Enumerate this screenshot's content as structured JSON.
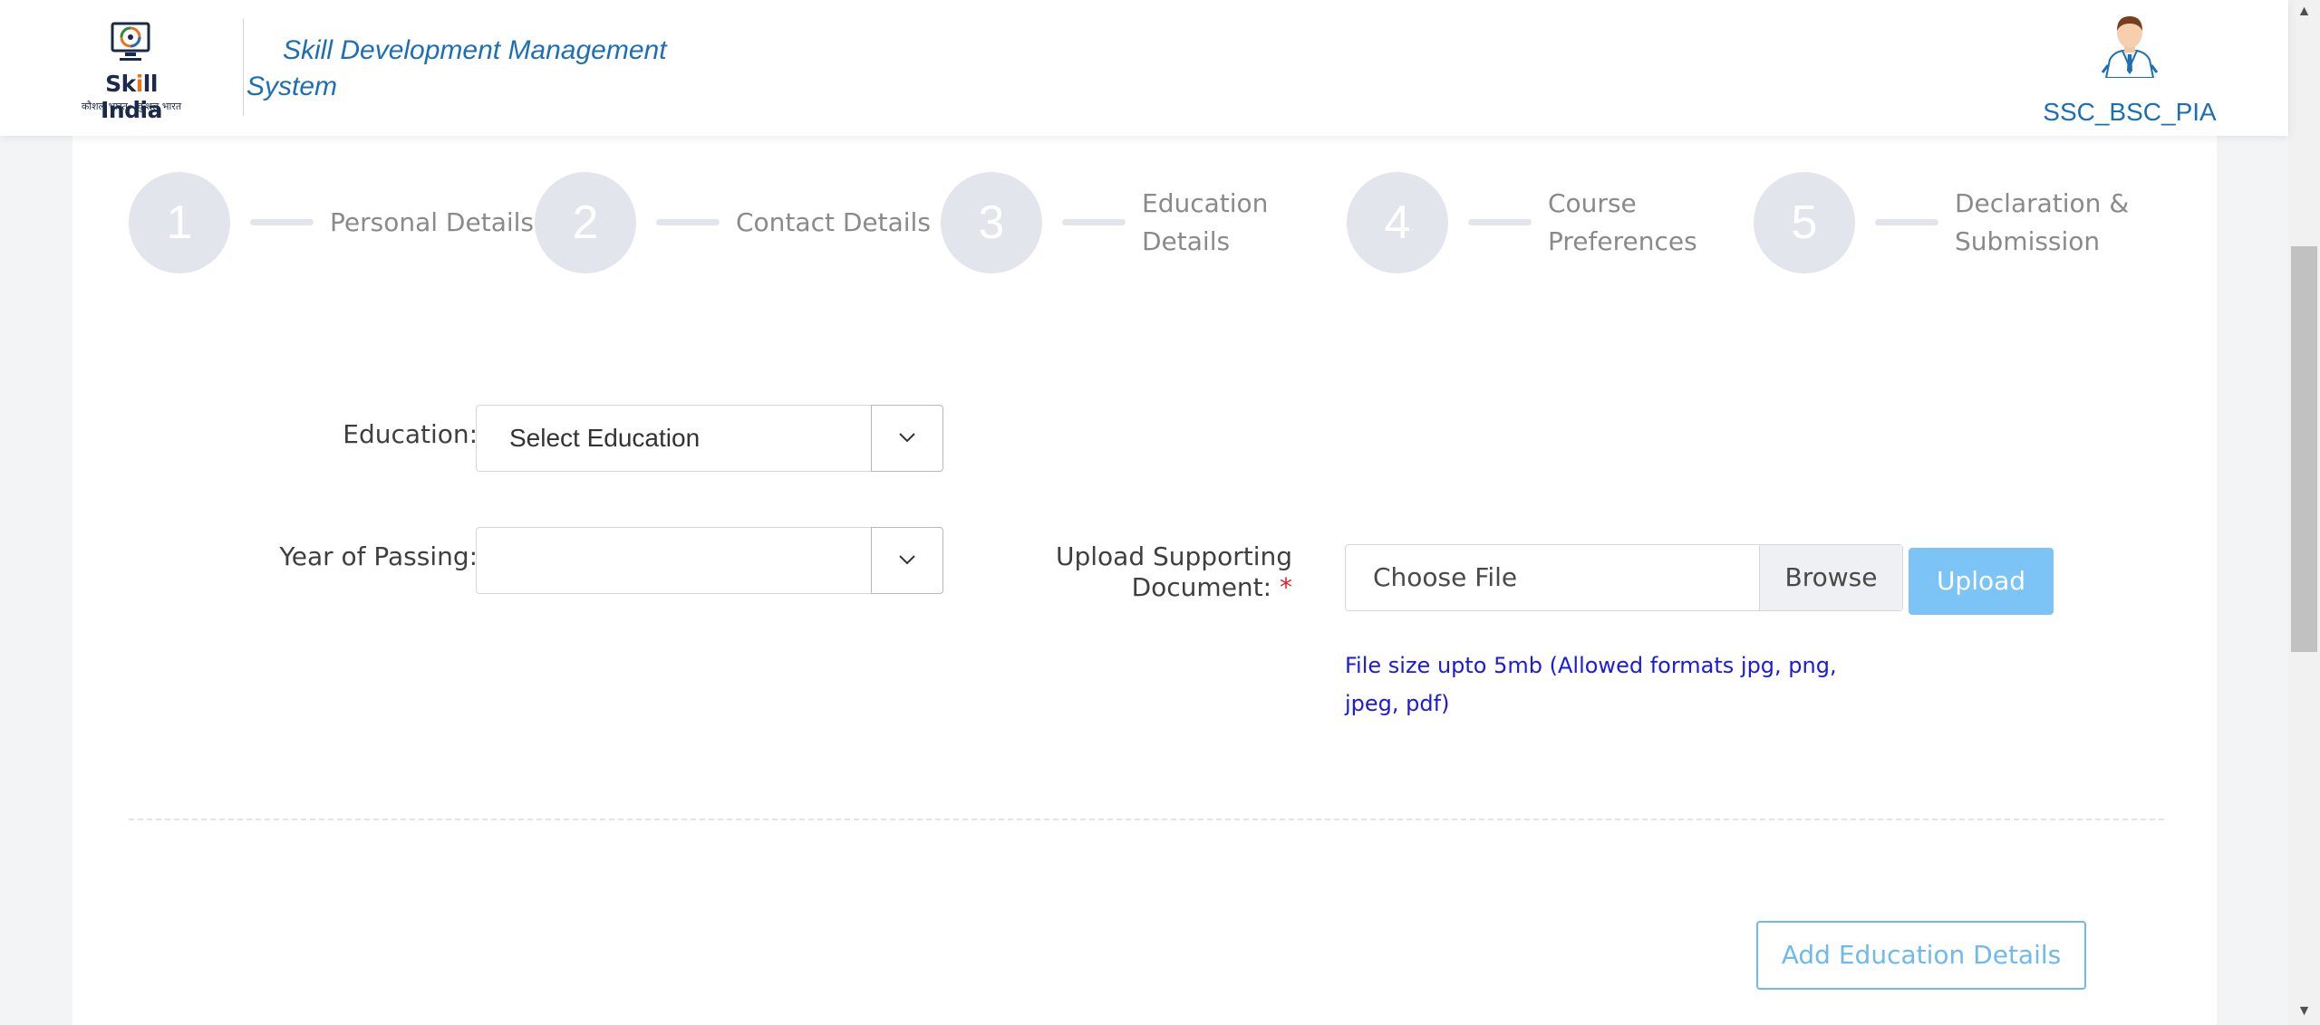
{
  "header": {
    "logo_word_pre": "Sk",
    "logo_word_accent": "i",
    "logo_word_mid": "ll India",
    "logo_tagline": "कौशल भारत - कुशल भारत",
    "app_title": "Skill Development Management System",
    "user_name": "SSC_BSC_PIA"
  },
  "stepper": {
    "steps": [
      {
        "number": "1",
        "label": "Personal Details"
      },
      {
        "number": "2",
        "label": "Contact Details"
      },
      {
        "number": "3",
        "label": "Education Details"
      },
      {
        "number": "4",
        "label": "Course Preferences"
      },
      {
        "number": "5",
        "label": "Declaration & Submission"
      }
    ]
  },
  "form": {
    "education": {
      "label": "Education:",
      "required_mark": "*",
      "value": "Select Education"
    },
    "year_of_passing": {
      "label": "Year of Passing:",
      "required_mark": "*",
      "value": ""
    },
    "upload": {
      "label_line1": "Upload Supporting",
      "label_line2": "Document:",
      "required_mark": "*",
      "file_placeholder": "Choose File",
      "browse_label": "Browse",
      "upload_label": "Upload",
      "hint": "File size upto 5mb (Allowed formats jpg, png, jpeg, pdf)"
    },
    "add_button_label": "Add Education Details"
  },
  "colors": {
    "brand_blue": "#1d6fb5",
    "step_inactive": "#e2e5ec",
    "required_red": "#e02424",
    "upload_button": "#7cc4f6",
    "hint_text": "#1a1ae0"
  },
  "icons": {
    "dropdown": "chevron-down-icon",
    "scroll_up": "triangle-up-icon",
    "scroll_down": "triangle-down-icon"
  }
}
